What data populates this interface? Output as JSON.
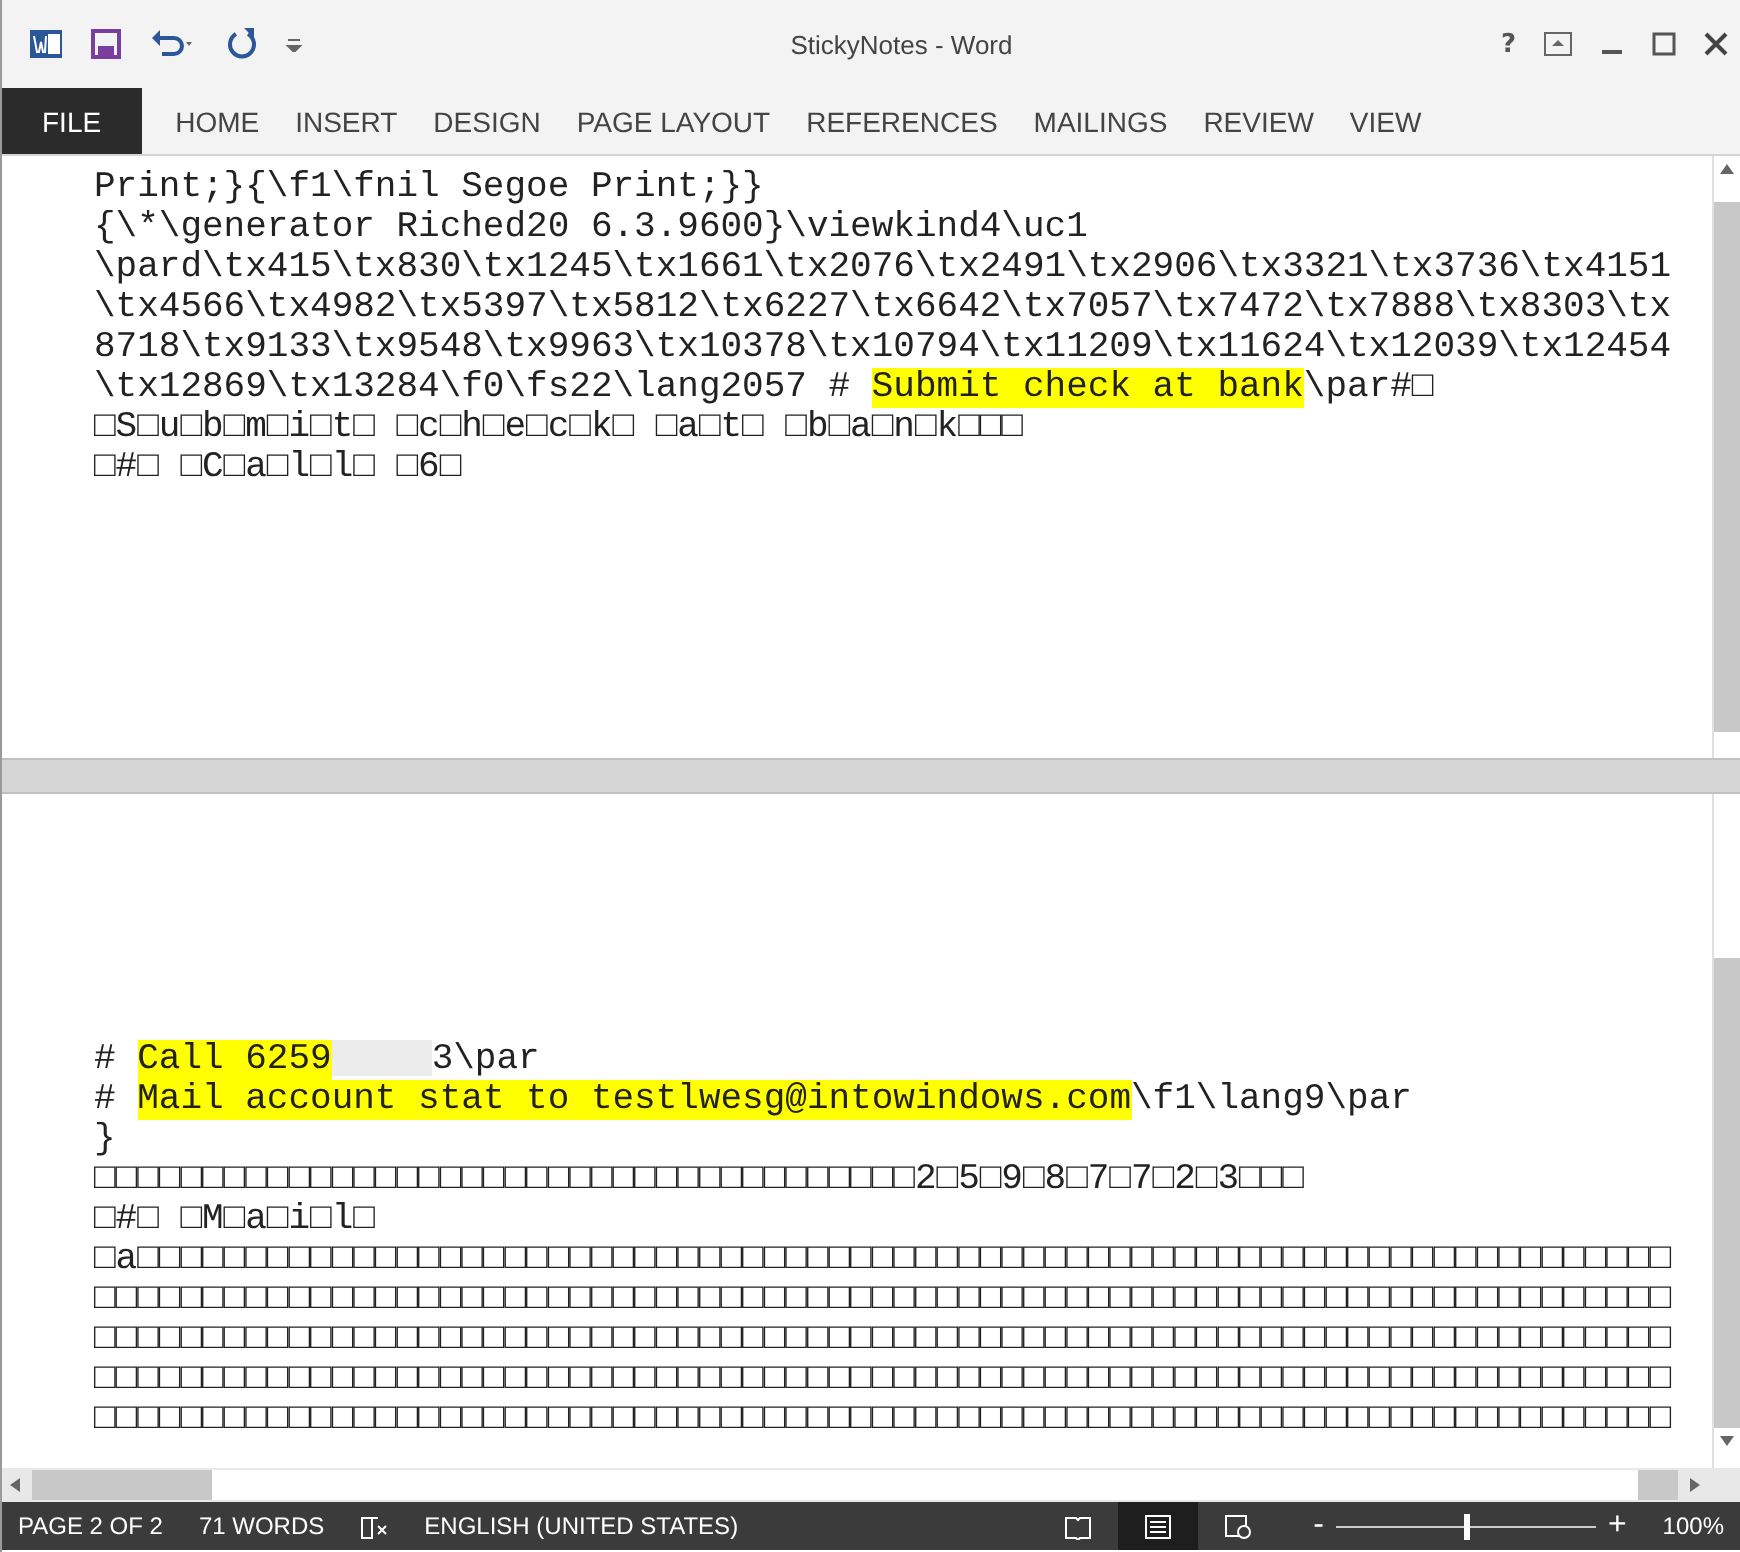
{
  "window": {
    "title": "StickyNotes - Word"
  },
  "ribbon_tabs": [
    {
      "label": "FILE",
      "kind": "file"
    },
    {
      "label": "HOME",
      "kind": "tab"
    },
    {
      "label": "INSERT",
      "kind": "tab"
    },
    {
      "label": "DESIGN",
      "kind": "tab"
    },
    {
      "label": "PAGE LAYOUT",
      "kind": "tab"
    },
    {
      "label": "REFERENCES",
      "kind": "tab"
    },
    {
      "label": "MAILINGS",
      "kind": "tab"
    },
    {
      "label": "REVIEW",
      "kind": "tab"
    },
    {
      "label": "VIEW",
      "kind": "tab"
    }
  ],
  "window_buttons": [
    {
      "label": "?"
    }
  ],
  "top_pane": {
    "lines": [
      [
        {
          "text": "Print;}{\\f1\\fnil Segoe Print;}}",
          "highlight": false
        }
      ],
      [
        {
          "text": "{\\*\\generator Riched20 6.3.9600}\\viewkind4\\uc1",
          "highlight": false
        }
      ],
      [
        {
          "text": "\\pard\\tx415\\tx830\\tx1245\\tx1661\\tx2076\\tx2491\\tx2906\\tx3321\\tx3736\\tx4151",
          "highlight": false
        }
      ],
      [
        {
          "text": "\\tx4566\\tx4982\\tx5397\\tx5812\\tx6227\\tx6642\\tx7057\\tx7472\\tx7888\\tx8303\\tx",
          "highlight": false
        }
      ],
      [
        {
          "text": "8718\\tx9133\\tx9548\\tx9963\\tx10378\\tx10794\\tx11209\\tx11624\\tx12039\\tx12454",
          "highlight": false
        }
      ],
      [
        {
          "text": "\\tx12869\\tx13284\\f0\\fs22\\lang2057 # ",
          "highlight": false
        },
        {
          "text": "Submit check at bank",
          "highlight": true
        },
        {
          "text": "\\par#□",
          "highlight": false
        }
      ],
      [
        {
          "text": "□S□u□b□m□i□t□ □c□h□e□c□k□ □a□t□ □b□a□n□k□□□",
          "highlight": false
        }
      ],
      [
        {
          "text": "□#□ □C□a□l□l□ □6□",
          "highlight": false
        }
      ]
    ]
  },
  "bottom_pane": {
    "lines": [
      [
        {
          "text": "# ",
          "highlight": false
        },
        {
          "text": "Call 6259",
          "highlight": true
        },
        {
          "kind": "redacted"
        },
        {
          "text": "3\\par",
          "highlight": false
        }
      ],
      [
        {
          "text": "# ",
          "highlight": false
        },
        {
          "text": "Mail account stat to testlwesg@intowindows.com",
          "highlight": true
        },
        {
          "text": "\\f1\\lang9\\par",
          "highlight": false
        }
      ],
      [
        {
          "text": "}",
          "highlight": false
        }
      ],
      [
        {
          "text": "□□□□□□□□□□□□□□□□□□□□□□□□□□□□□□□□□□□□□□2□5□9□8□7□7□2□3□□□",
          "highlight": false
        }
      ],
      [
        {
          "text": "□#□ □M□a□i□l□",
          "highlight": false
        }
      ],
      [
        {
          "text": "□a□□□□□□□□□□□□□□□□□□□□□□□□□□□□□□□□□□□□□□□□□□□□□□□□□□□□□□□□□□□□□□□□□□□□□□□",
          "highlight": false
        }
      ],
      [
        {
          "text": "□□□□□□□□□□□□□□□□□□□□□□□□□□□□□□□□□□□□□□□□□□□□□□□□□□□□□□□□□□□□□□□□□□□□□□□□□",
          "highlight": false
        }
      ],
      [
        {
          "text": "□□□□□□□□□□□□□□□□□□□□□□□□□□□□□□□□□□□□□□□□□□□□□□□□□□□□□□□□□□□□□□□□□□□□□□□□□",
          "highlight": false
        }
      ],
      [
        {
          "text": "□□□□□□□□□□□□□□□□□□□□□□□□□□□□□□□□□□□□□□□□□□□□□□□□□□□□□□□□□□□□□□□□□□□□□□□□□",
          "highlight": false
        }
      ],
      [
        {
          "text": "□□□□□□□□□□□□□□□□□□□□□□□□□□□□□□□□□□□□□□□□□□□□□□□□□□□□□□□□□□□□□□□□□□□□□□□□□",
          "highlight": false
        }
      ]
    ]
  },
  "status_bar": {
    "page": "PAGE 2 OF 2",
    "words": "71 WORDS",
    "language": "ENGLISH (UNITED STATES)",
    "views": [
      {
        "kind": "read",
        "selected": false
      },
      {
        "kind": "print",
        "selected": true
      },
      {
        "kind": "web",
        "selected": false
      }
    ],
    "zoom": {
      "minus": "-",
      "plus": "+",
      "level": 0.5,
      "reading": "100%"
    }
  }
}
